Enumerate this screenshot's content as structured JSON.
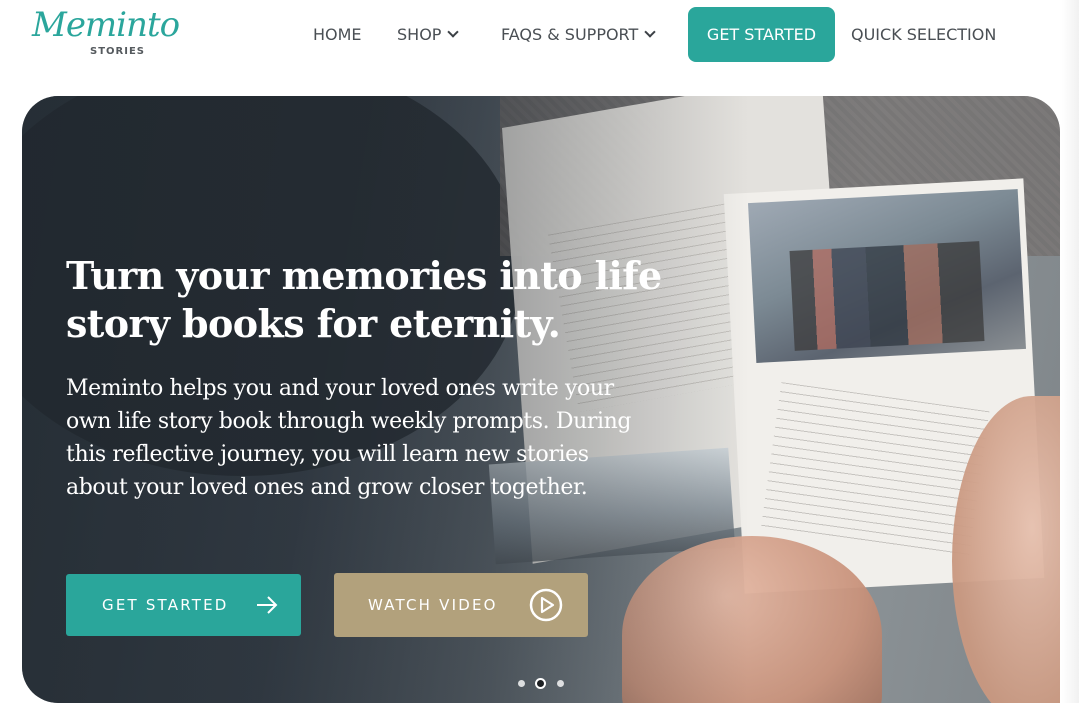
{
  "logo": {
    "script_text": "Meminto",
    "sub_text": "STORIES",
    "brand_color": "#2ba69c"
  },
  "nav": {
    "items": [
      {
        "label": "HOME"
      },
      {
        "label": "SHOP",
        "has_dropdown": true
      },
      {
        "label": "FAQS & SUPPORT",
        "has_dropdown": true
      }
    ],
    "cta_label": "GET STARTED",
    "quick_label": "QUICK SELECTION",
    "cta_color": "#2aa69b"
  },
  "hero": {
    "title": "Turn your memories into life story books for eternity.",
    "description": "Meminto helps you and your loved ones write your own life story book through weekly prompts. During this reflective journey, you will learn new stories about your loved ones and grow closer together.",
    "primary_button": {
      "label": "GET STARTED",
      "icon": "arrow-right-icon",
      "color": "#2aa69b"
    },
    "secondary_button": {
      "label": "WATCH VIDEO",
      "icon": "play-circle-icon",
      "color": "#b2a17c"
    },
    "slides_total": 3,
    "active_slide": 2
  }
}
